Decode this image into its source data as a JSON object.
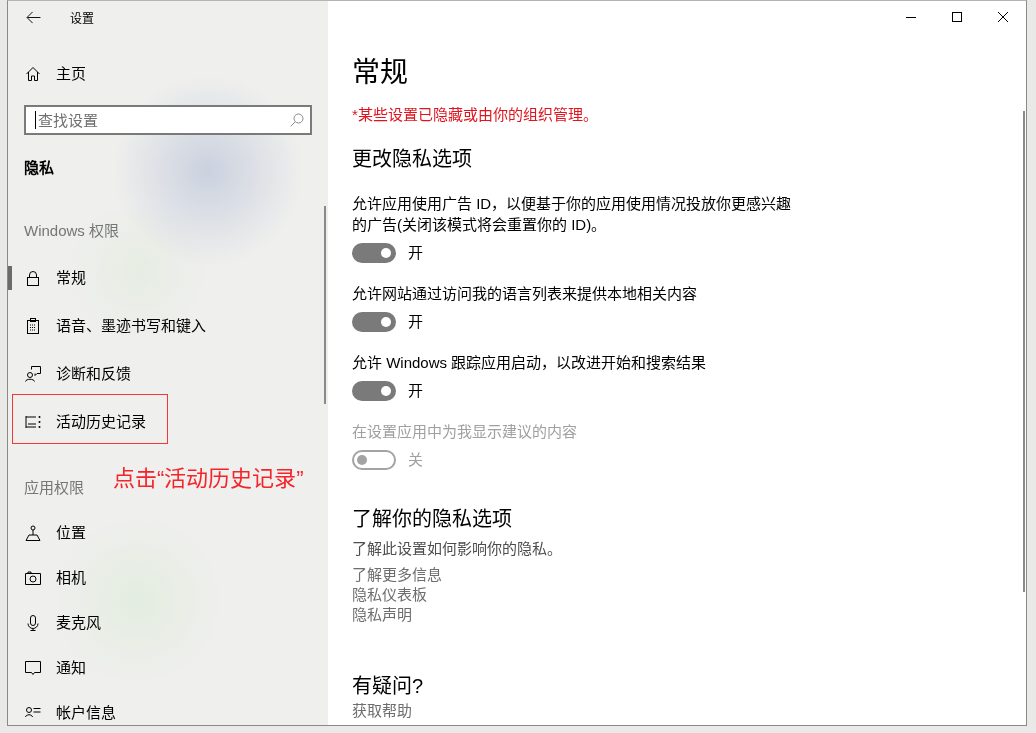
{
  "window": {
    "title": "设置"
  },
  "sidebar": {
    "home": {
      "label": "主页"
    },
    "search": {
      "placeholder": "查找设置",
      "focused": true
    },
    "heading": "隐私",
    "groups": [
      {
        "title": "Windows 权限",
        "items": [
          {
            "label": "常规",
            "selected": true,
            "highlighted": false
          },
          {
            "label": "语音、墨迹书写和键入",
            "selected": false,
            "highlighted": false
          },
          {
            "label": "诊断和反馈",
            "selected": false,
            "highlighted": false
          },
          {
            "label": "活动历史记录",
            "selected": false,
            "highlighted": true
          }
        ]
      },
      {
        "title": "应用权限",
        "items": [
          {
            "label": "位置",
            "selected": false,
            "highlighted": false
          },
          {
            "label": "相机",
            "selected": false,
            "highlighted": false
          },
          {
            "label": "麦克风",
            "selected": false,
            "highlighted": false
          },
          {
            "label": "通知",
            "selected": false,
            "highlighted": false
          },
          {
            "label": "帐户信息",
            "selected": false,
            "highlighted": false
          }
        ]
      }
    ]
  },
  "main": {
    "title": "常规",
    "notice": "*某些设置已隐藏或由你的组织管理。",
    "privacy_options": {
      "heading": "更改隐私选项",
      "options": [
        {
          "label": "允许应用使用广告 ID，以便基于你的应用使用情况投放你更感兴趣的广告(关闭该模式将会重置你的 ID)。",
          "on": true,
          "disabled": false,
          "state_label": "开"
        },
        {
          "label": "允许网站通过访问我的语言列表来提供本地相关内容",
          "on": true,
          "disabled": false,
          "state_label": "开"
        },
        {
          "label": "允许 Windows 跟踪应用启动，以改进开始和搜索结果",
          "on": true,
          "disabled": false,
          "state_label": "开"
        },
        {
          "label": "在设置应用中为我显示建议的内容",
          "on": false,
          "disabled": true,
          "state_label": "关"
        }
      ]
    },
    "learn": {
      "heading": "了解你的隐私选项",
      "description": "了解此设置如何影响你的隐私。",
      "links": [
        "了解更多信息",
        "隐私仪表板",
        "隐私声明"
      ]
    },
    "help": {
      "heading": "有疑问?",
      "links": [
        "获取帮助"
      ]
    }
  },
  "annotation": {
    "text": "点击“活动历史记录”"
  }
}
